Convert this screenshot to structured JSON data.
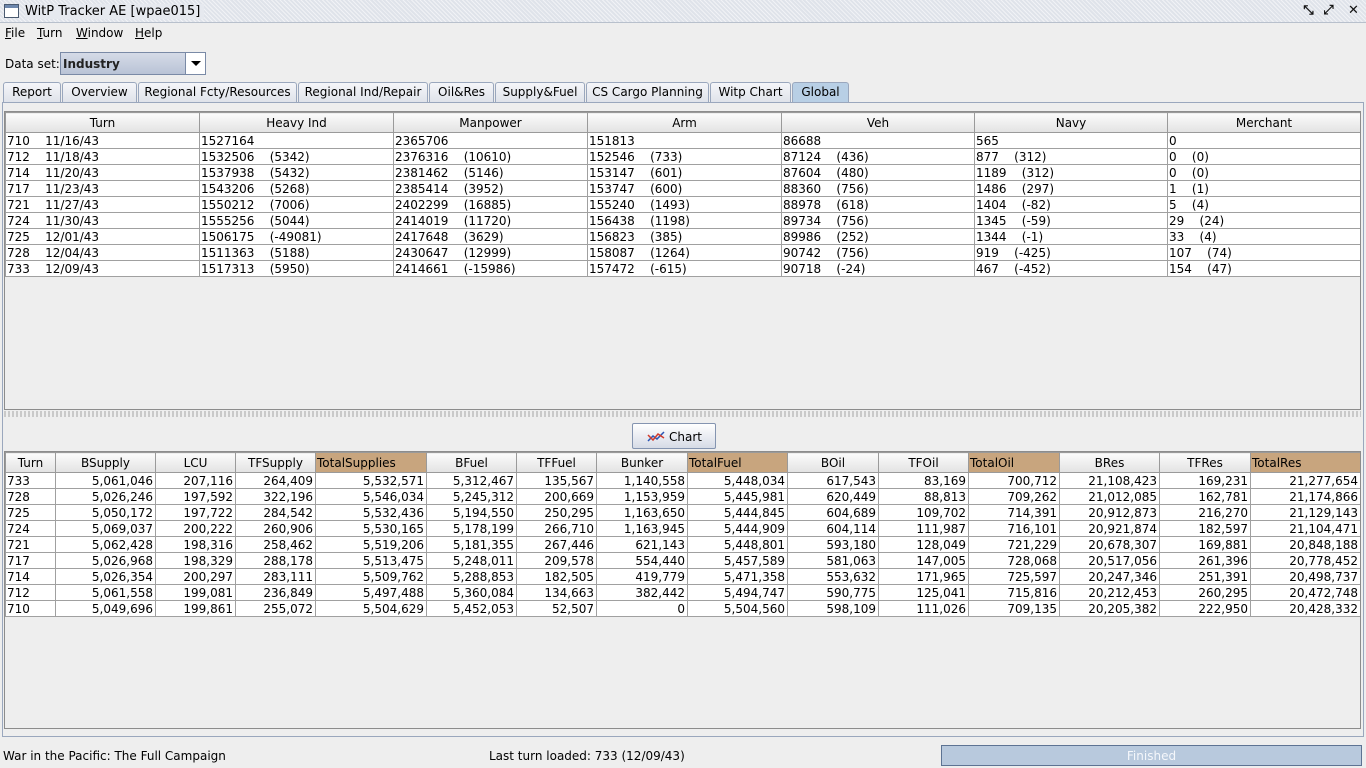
{
  "window": {
    "title": "WitP Tracker AE [wpae015]"
  },
  "menu": [
    {
      "label": "File",
      "mnemonic": "F",
      "rest": "ile"
    },
    {
      "label": "Turn",
      "mnemonic": "T",
      "rest": "urn"
    },
    {
      "label": "Window",
      "mnemonic": "W",
      "rest": "indow"
    },
    {
      "label": "Help",
      "mnemonic": "H",
      "rest": "elp"
    }
  ],
  "dataset": {
    "label": "Data set:",
    "value": "Industry"
  },
  "tabs": [
    {
      "label": "Report"
    },
    {
      "label": "Overview"
    },
    {
      "label": "Regional Fcty/Resources"
    },
    {
      "label": "Regional Ind/Repair"
    },
    {
      "label": "Oil&Res"
    },
    {
      "label": "Supply&Fuel"
    },
    {
      "label": "CS Cargo Planning"
    },
    {
      "label": "Witp Chart"
    },
    {
      "label": "Global",
      "active": true
    }
  ],
  "industry_table": {
    "columns": [
      "Turn",
      "Heavy Ind",
      "Manpower",
      "Arm",
      "Veh",
      "Navy",
      "Merchant"
    ],
    "rows": [
      [
        "710    11/16/43",
        "1527164",
        "2365706",
        "151813",
        "86688",
        "565",
        "0"
      ],
      [
        "712    11/18/43",
        "1532506    (5342)",
        "2376316    (10610)",
        "152546    (733)",
        "87124    (436)",
        "877    (312)",
        "0    (0)"
      ],
      [
        "714    11/20/43",
        "1537938    (5432)",
        "2381462    (5146)",
        "153147    (601)",
        "87604    (480)",
        "1189    (312)",
        "0    (0)"
      ],
      [
        "717    11/23/43",
        "1543206    (5268)",
        "2385414    (3952)",
        "153747    (600)",
        "88360    (756)",
        "1486    (297)",
        "1    (1)"
      ],
      [
        "721    11/27/43",
        "1550212    (7006)",
        "2402299    (16885)",
        "155240    (1493)",
        "88978    (618)",
        "1404    (-82)",
        "5    (4)"
      ],
      [
        "724    11/30/43",
        "1555256    (5044)",
        "2414019    (11720)",
        "156438    (1198)",
        "89734    (756)",
        "1345    (-59)",
        "29    (24)"
      ],
      [
        "725    12/01/43",
        "1506175    (-49081)",
        "2417648    (3629)",
        "156823    (385)",
        "89986    (252)",
        "1344    (-1)",
        "33    (4)"
      ],
      [
        "728    12/04/43",
        "1511363    (5188)",
        "2430647    (12999)",
        "158087    (1264)",
        "90742    (756)",
        "919    (-425)",
        "107    (74)"
      ],
      [
        "733    12/09/43",
        "1517313    (5950)",
        "2414661    (-15986)",
        "157472    (-615)",
        "90718    (-24)",
        "467    (-452)",
        "154    (47)"
      ]
    ]
  },
  "chart_button": {
    "label": "Chart"
  },
  "supply_table": {
    "columns": [
      "Turn",
      "BSupply",
      "LCU",
      "TFSupply",
      "TotalSupplies",
      "BFuel",
      "TFFuel",
      "Bunker",
      "TotalFuel",
      "BOil",
      "TFOil",
      "TotalOil",
      "BRes",
      "TFRes",
      "TotalRes"
    ],
    "highlighted": [
      "TotalSupplies",
      "TotalFuel",
      "TotalOil",
      "TotalRes"
    ],
    "highlight_color": "#c8a57e",
    "rows": [
      [
        "733",
        "5,061,046",
        "207,116",
        "264,409",
        "5,532,571",
        "5,312,467",
        "135,567",
        "1,140,558",
        "5,448,034",
        "617,543",
        "83,169",
        "700,712",
        "21,108,423",
        "169,231",
        "21,277,654"
      ],
      [
        "728",
        "5,026,246",
        "197,592",
        "322,196",
        "5,546,034",
        "5,245,312",
        "200,669",
        "1,153,959",
        "5,445,981",
        "620,449",
        "88,813",
        "709,262",
        "21,012,085",
        "162,781",
        "21,174,866"
      ],
      [
        "725",
        "5,050,172",
        "197,722",
        "284,542",
        "5,532,436",
        "5,194,550",
        "250,295",
        "1,163,650",
        "5,444,845",
        "604,689",
        "109,702",
        "714,391",
        "20,912,873",
        "216,270",
        "21,129,143"
      ],
      [
        "724",
        "5,069,037",
        "200,222",
        "260,906",
        "5,530,165",
        "5,178,199",
        "266,710",
        "1,163,945",
        "5,444,909",
        "604,114",
        "111,987",
        "716,101",
        "20,921,874",
        "182,597",
        "21,104,471"
      ],
      [
        "721",
        "5,062,428",
        "198,316",
        "258,462",
        "5,519,206",
        "5,181,355",
        "267,446",
        "621,143",
        "5,448,801",
        "593,180",
        "128,049",
        "721,229",
        "20,678,307",
        "169,881",
        "20,848,188"
      ],
      [
        "717",
        "5,026,968",
        "198,329",
        "288,178",
        "5,513,475",
        "5,248,011",
        "209,578",
        "554,440",
        "5,457,589",
        "581,063",
        "147,005",
        "728,068",
        "20,517,056",
        "261,396",
        "20,778,452"
      ],
      [
        "714",
        "5,026,354",
        "200,297",
        "283,111",
        "5,509,762",
        "5,288,853",
        "182,505",
        "419,779",
        "5,471,358",
        "553,632",
        "171,965",
        "725,597",
        "20,247,346",
        "251,391",
        "20,498,737"
      ],
      [
        "712",
        "5,061,558",
        "199,081",
        "236,849",
        "5,497,488",
        "5,360,084",
        "134,663",
        "382,442",
        "5,494,747",
        "590,775",
        "125,041",
        "715,816",
        "20,212,453",
        "260,295",
        "20,472,748"
      ],
      [
        "710",
        "5,049,696",
        "199,861",
        "255,072",
        "5,504,629",
        "5,452,053",
        "52,507",
        "0",
        "5,504,560",
        "598,109",
        "111,026",
        "709,135",
        "20,205,382",
        "222,950",
        "20,428,332"
      ]
    ]
  },
  "status": {
    "campaign": "War in the Pacific: The Full Campaign",
    "last_turn": "Last turn loaded: 733 (12/09/43)",
    "progress_label": "Finished",
    "progress": 1.0
  }
}
